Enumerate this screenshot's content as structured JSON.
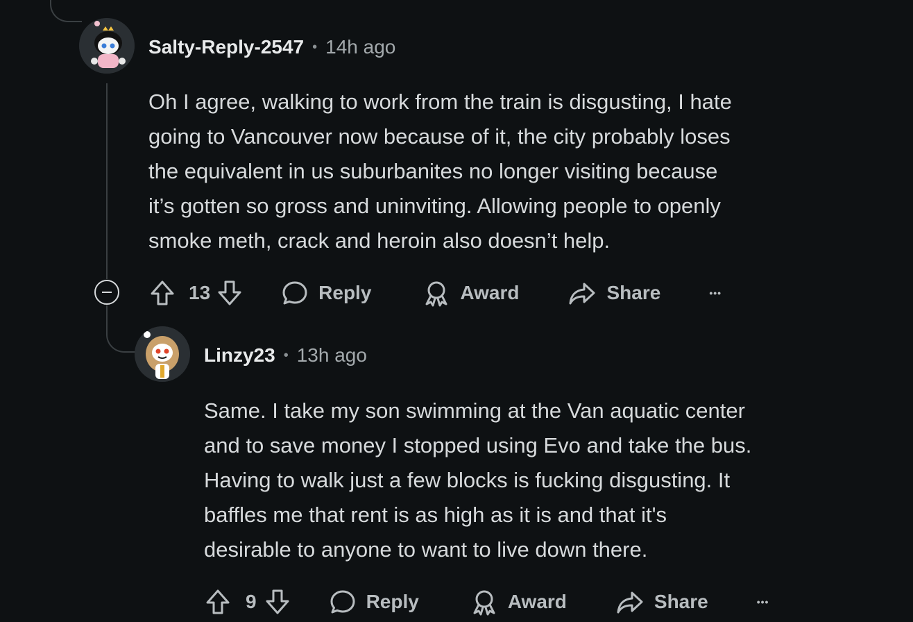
{
  "comments": [
    {
      "username": "Salty-Reply-2547",
      "separator": "•",
      "time": "14h ago",
      "body_lines": [
        "Oh I agree, walking to work from the train is disgusting, I hate",
        "going to Vancouver now because of it, the city probably loses",
        "the equivalent in us suburbanites no longer visiting because",
        "it’s gotten so gross and uninviting. Allowing people to openly",
        "smoke meth, crack and heroin also doesn’t help."
      ],
      "votes": "13",
      "reply_label": "Reply",
      "award_label": "Award",
      "share_label": "Share",
      "more_label": "•••"
    },
    {
      "username": "Linzy23",
      "separator": "•",
      "time": "13h ago",
      "body_lines": [
        "Same. I take my son swimming at the Van aquatic center",
        "and to save money I stopped using Evo and take the bus.",
        "Having to walk just a few blocks is fucking disgusting. It",
        "baffles me that rent is as high as it is and that it's",
        "desirable to anyone to want to live down there."
      ],
      "votes": "9",
      "reply_label": "Reply",
      "award_label": "Award",
      "share_label": "Share",
      "more_label": "•••"
    }
  ],
  "icons": {
    "upvote": "arrow-up-icon",
    "downvote": "arrow-down-icon",
    "reply": "speech-bubble-icon",
    "award": "award-ribbon-icon",
    "share": "share-arrow-icon",
    "more": "ellipsis-icon",
    "collapse": "collapse-minus-icon"
  },
  "colors": {
    "background": "#0e1113",
    "text": "#d7dadc",
    "muted": "#a3a9ac",
    "thread_line": "#3a3f42"
  }
}
